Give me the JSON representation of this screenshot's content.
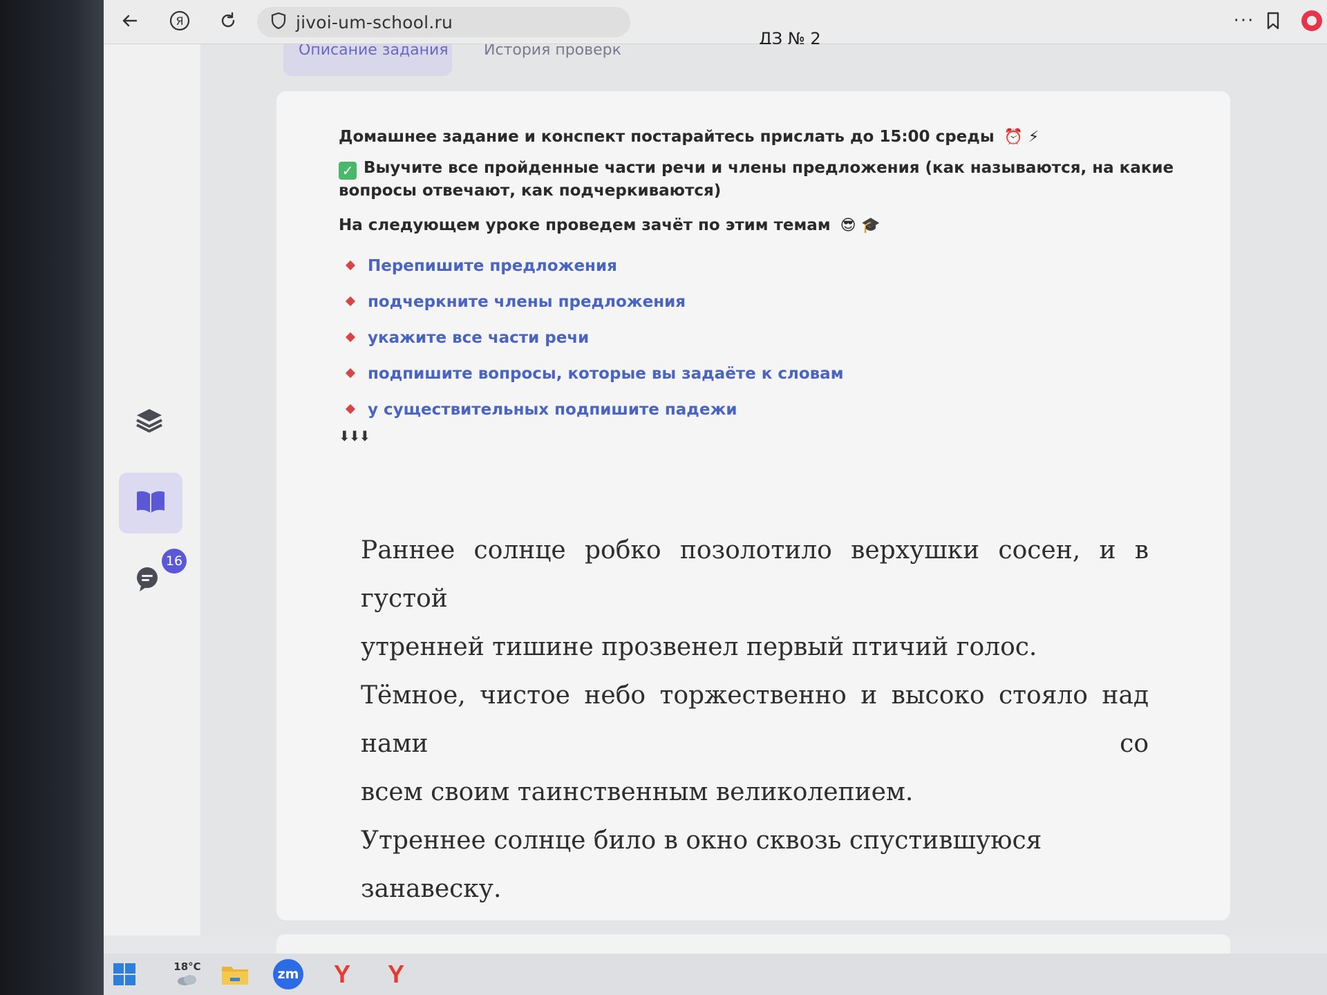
{
  "browser": {
    "url": "jivoi-um-school.ru",
    "page_title": "ДЗ № 2",
    "more_label": "···"
  },
  "tabs": [
    {
      "label": "Описание задания",
      "active": true
    },
    {
      "label": "История проверки",
      "active": false
    }
  ],
  "sidebar": {
    "chat_badge": "16"
  },
  "homework": {
    "deadline": "Домашнее задание и конспект постарайтесь прислать до 15:00 среды",
    "deadline_emoji": "⏰ ⚡",
    "check_mark": "✓",
    "learn_task": "Выучите все пройденные части речи и члены предложения (как называются, на какие вопросы отвечают, как подчеркиваются)",
    "test_note": "На следующем уроке проведем зачёт по этим темам",
    "test_emoji": "😎 🎓",
    "steps": [
      "Перепишите предложения",
      "подчеркните члены предложения",
      "укажите все части речи",
      "подпишите вопросы, которые вы задаёте к словам",
      "у существительных подпишите падежи"
    ],
    "arrows": "⬇⬇⬇"
  },
  "passage": {
    "lines": [
      "Раннее солнце робко позолотило верхушки сосен, и в густой",
      "утренней тишине прозвенел первый птичий голос.",
      "Тёмное, чистое небо торжественно и высоко стояло над нами со",
      "всем своим таинственным великолепием.",
      "Утреннее солнце било в окно сквозь спустившуюся занавеску."
    ]
  },
  "taskbar": {
    "temperature": "18°C",
    "zoom_label": "zm",
    "yandex_label": "Y"
  },
  "colors": {
    "accent": "#5a58d6",
    "link": "#4a64c2",
    "bullet": "#d94545",
    "check": "#49b86a",
    "yandex": "#e53b30"
  }
}
